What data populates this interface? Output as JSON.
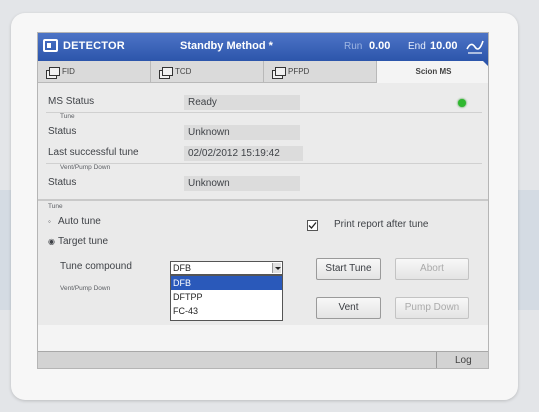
{
  "titlebar": {
    "title": "DETECTOR",
    "method": "Standby Method *",
    "run_label": "Run",
    "run_value": "0.00",
    "end_label": "End",
    "end_value": "10.00",
    "icons": {
      "window": "window-icon",
      "signal": "signal-icon"
    }
  },
  "tabs": [
    {
      "label": "FID",
      "icon": "detector-icon",
      "active": false
    },
    {
      "label": "TCD",
      "icon": "detector-icon",
      "active": false
    },
    {
      "label": "PFPD",
      "icon": "detector-icon",
      "active": false
    },
    {
      "label": "Scion MS",
      "icon": "",
      "active": true
    }
  ],
  "status": {
    "ms_status_label": "MS Status",
    "ms_status_value": "Ready",
    "tune_section": "Tune",
    "tune_status_label": "Status",
    "tune_status_value": "Unknown",
    "last_tune_label": "Last successful tune",
    "last_tune_value": "02/02/2012 15:19:42",
    "vent_section": "Vent/Pump Down",
    "vent_status_label": "Status",
    "vent_status_value": "Unknown",
    "indicator_color": "#2fb82f"
  },
  "tune": {
    "section": "Tune",
    "auto_tune_label": "Auto tune",
    "target_tune_label": "Target tune",
    "selected_mode": "Target tune",
    "compound_label": "Tune compound",
    "compound_value": "DFB",
    "compound_options": [
      "DFB",
      "DFTPP",
      "FC-43"
    ],
    "highlighted_option": "DFB",
    "print_report_label": "Print report after tune",
    "print_report_checked": true,
    "start_tune": "Start Tune",
    "abort": "Abort",
    "vent_pump_label": "Vent/Pump Down",
    "vent": "Vent",
    "pump_down": "Pump Down"
  },
  "statusbar": {
    "log": "Log"
  },
  "colors": {
    "titlebar": "#2c55ab",
    "highlight": "#2a59ba",
    "indicator": "#2fb82f"
  }
}
